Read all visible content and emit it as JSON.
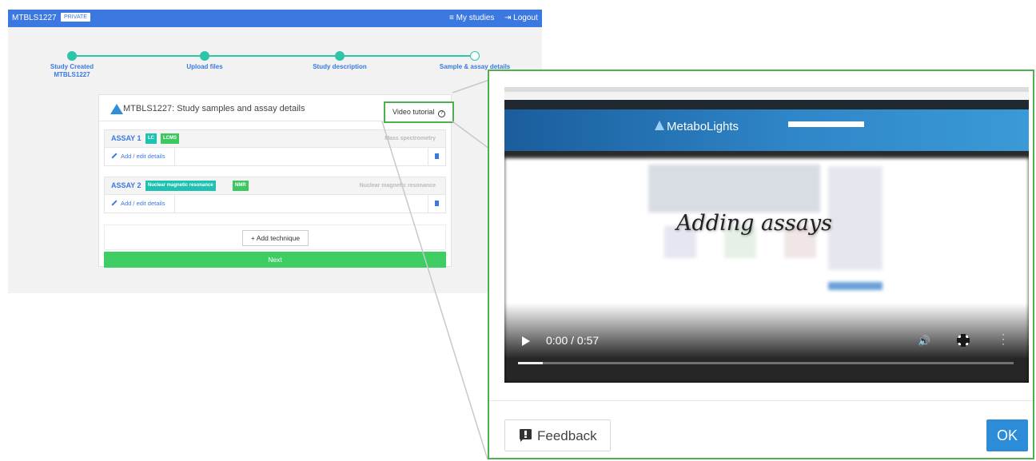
{
  "topbar": {
    "study_id": "MTBLS1227",
    "badge": "PRIVATE",
    "my_studies": "≡ My studies",
    "logout": "⇥ Logout"
  },
  "stepper": {
    "steps": [
      {
        "label": "Study Created",
        "sublabel": "MTBLS1227",
        "completed": true
      },
      {
        "label": "Upload files",
        "completed": true
      },
      {
        "label": "Study description",
        "completed": true
      },
      {
        "label": "Sample & assay details",
        "completed": false
      }
    ]
  },
  "card": {
    "title": "MTBLS1227: Study samples and assay details",
    "video_tutorial": "Video tutorial",
    "assays": [
      {
        "name": "ASSAY 1",
        "tags": [
          "LC",
          "LCMS"
        ],
        "type": "Mass spectrometry",
        "edit_label": "Add / edit details"
      },
      {
        "name": "ASSAY 2",
        "tags": [
          "Nuclear magnetic resonance",
          "NMR"
        ],
        "type": "Nuclear magnetic resonance",
        "edit_label": "Add / edit details"
      }
    ],
    "add_technique": "+ Add technique",
    "next": "Next"
  },
  "modal": {
    "video": {
      "site_name": "MetaboLights",
      "caption": "Adding assays",
      "time": "0:00 / 0:57",
      "progress": 0.05
    },
    "feedback": "Feedback",
    "ok": "OK"
  },
  "colors": {
    "primary": "#3b78e0",
    "teal": "#2ec4a8",
    "green": "#3dcd63",
    "highlight": "#4caf50",
    "ok_button": "#2d8cd8"
  }
}
